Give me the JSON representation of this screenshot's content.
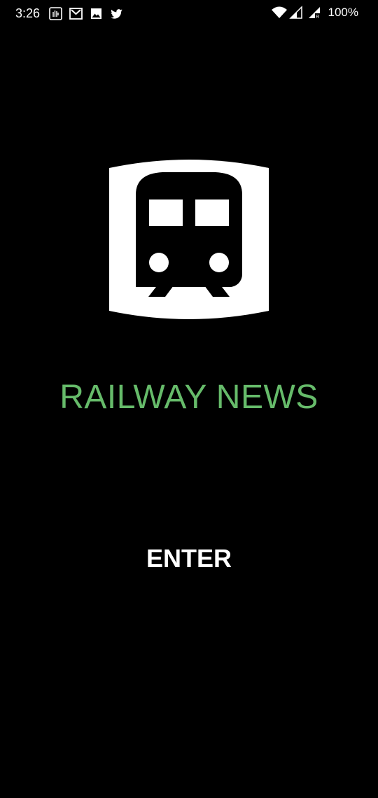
{
  "status_bar": {
    "time": "3:26",
    "battery_percent": "100%",
    "notification_icons": [
      "hand-wave-icon",
      "gmail-icon",
      "image-icon",
      "twitter-icon"
    ],
    "system_icons": [
      "wifi-icon",
      "signal-icon",
      "signal-roaming-icon"
    ]
  },
  "app": {
    "logo_icon": "train-icon",
    "title": "RAILWAY NEWS",
    "title_color": "#66bb6a",
    "enter_label": "ENTER"
  },
  "colors": {
    "background": "#000000",
    "text": "#ffffff",
    "accent": "#66bb6a"
  }
}
